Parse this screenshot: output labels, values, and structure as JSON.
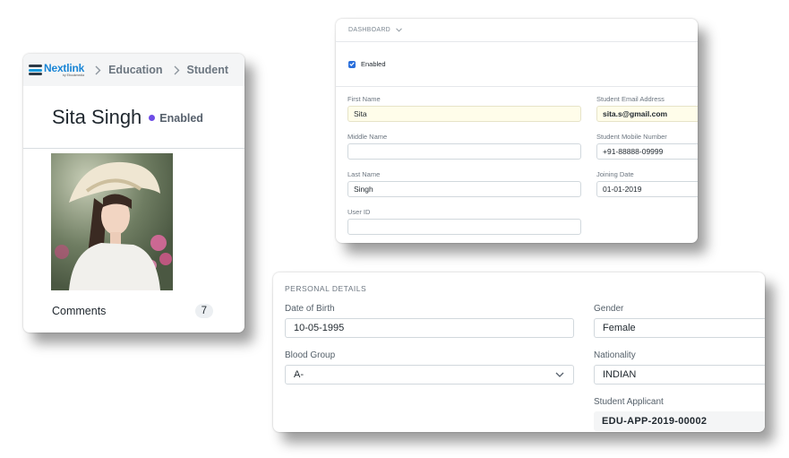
{
  "brand": {
    "name": "Nextlink",
    "tagline": "by Ebookmedia"
  },
  "breadcrumb": {
    "items": [
      "Education",
      "Student"
    ]
  },
  "student": {
    "name": "Sita Singh",
    "status": "Enabled",
    "status_color": "#6e4de6"
  },
  "sidebar": {
    "comments_label": "Comments",
    "comments_count": "7"
  },
  "form": {
    "section_label": "DASHBOARD",
    "enabled_label": "Enabled",
    "enabled_checked": true,
    "first_name": {
      "label": "First Name",
      "value": "Sita"
    },
    "middle_name": {
      "label": "Middle Name",
      "value": ""
    },
    "last_name": {
      "label": "Last Name",
      "value": "Singh"
    },
    "user_id": {
      "label": "User ID",
      "value": ""
    },
    "email": {
      "label": "Student Email Address",
      "value": "sita.s@gmail.com"
    },
    "mobile": {
      "label": "Student Mobile Number",
      "value": "+91-88888-09999"
    },
    "joining_date": {
      "label": "Joining Date",
      "value": "01-01-2019"
    }
  },
  "personal": {
    "section_label": "PERSONAL DETAILS",
    "dob": {
      "label": "Date of Birth",
      "value": "10-05-1995"
    },
    "blood_group": {
      "label": "Blood Group",
      "value": "A-"
    },
    "gender": {
      "label": "Gender",
      "value": "Female"
    },
    "nationality": {
      "label": "Nationality",
      "value": "INDIAN"
    },
    "applicant": {
      "label": "Student Applicant",
      "value": "EDU-APP-2019-00002"
    }
  },
  "colors": {
    "accent": "#1a86d6",
    "checkbox": "#2a6fdb",
    "highlight_field": "#fffdea"
  }
}
